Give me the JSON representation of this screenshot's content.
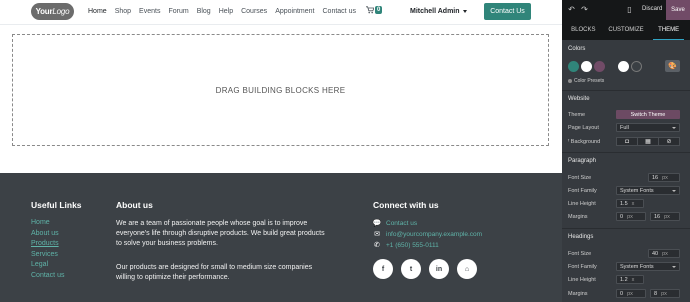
{
  "header": {
    "logo_a": "Your",
    "logo_b": "Logo",
    "nav": [
      "Home",
      "Shop",
      "Events",
      "Forum",
      "Blog",
      "Help",
      "Courses",
      "Appointment",
      "Contact us"
    ],
    "cart_count": "0",
    "user": "Mitchell Admin",
    "contact_button": "Contact Us"
  },
  "canvas": {
    "drop_text": "DRAG BUILDING BLOCKS HERE"
  },
  "footer": {
    "useful_links_title": "Useful Links",
    "links": [
      "Home",
      "About us",
      "Products",
      "Services",
      "Legal",
      "Contact us"
    ],
    "about_title": "About us",
    "about_p1": "We are a team of passionate people whose goal is to improve everyone's life through disruptive products. We build great products to solve your business problems.",
    "about_p2": "Our products are designed for small to medium size companies willing to optimize their performance.",
    "connect_title": "Connect with us",
    "contact_label": "Contact us",
    "email": "info@yourcompany.example.com",
    "phone": "+1 (650) 555-0111",
    "socials": [
      "f",
      "t",
      "in",
      "⌂"
    ]
  },
  "panel": {
    "discard": "Discard",
    "save": "Save",
    "tabs": [
      "BLOCKS",
      "CUSTOMIZE",
      "THEME"
    ],
    "colors_title": "Colors",
    "color_presets": "Color Presets",
    "palette": [
      "#30857a",
      "#ffffff",
      "#714b67",
      "#ffffff",
      "#3a3f44"
    ],
    "website_title": "Website",
    "theme_label": "Theme",
    "theme_button": "Switch Theme",
    "page_layout_label": "Page Layout",
    "page_layout_value": "Full",
    "background_label": "Background",
    "paragraph_title": "Paragraph",
    "p_font_size_label": "Font Size",
    "p_font_size_value": "16",
    "p_font_size_unit": "px",
    "p_font_family_label": "Font Family",
    "p_font_family_value": "System Fonts",
    "p_line_height_label": "Line Height",
    "p_line_height_value": "1.5",
    "p_line_height_unit": "x",
    "p_margins_label": "Margins",
    "p_margin_top": "0",
    "p_margin_bottom": "16",
    "p_margin_unit": "px",
    "headings_title": "Headings",
    "h_font_size_label": "Font Size",
    "h_font_size_value": "40",
    "h_font_size_unit": "px",
    "h_font_family_label": "Font Family",
    "h_font_family_value": "System Fonts",
    "h_line_height_label": "Line Height",
    "h_line_height_value": "1.2",
    "h_line_height_unit": "x",
    "h_margins_label": "Margins",
    "h_margin_top": "0",
    "h_margin_bottom": "8",
    "h_margin_unit": "px"
  }
}
